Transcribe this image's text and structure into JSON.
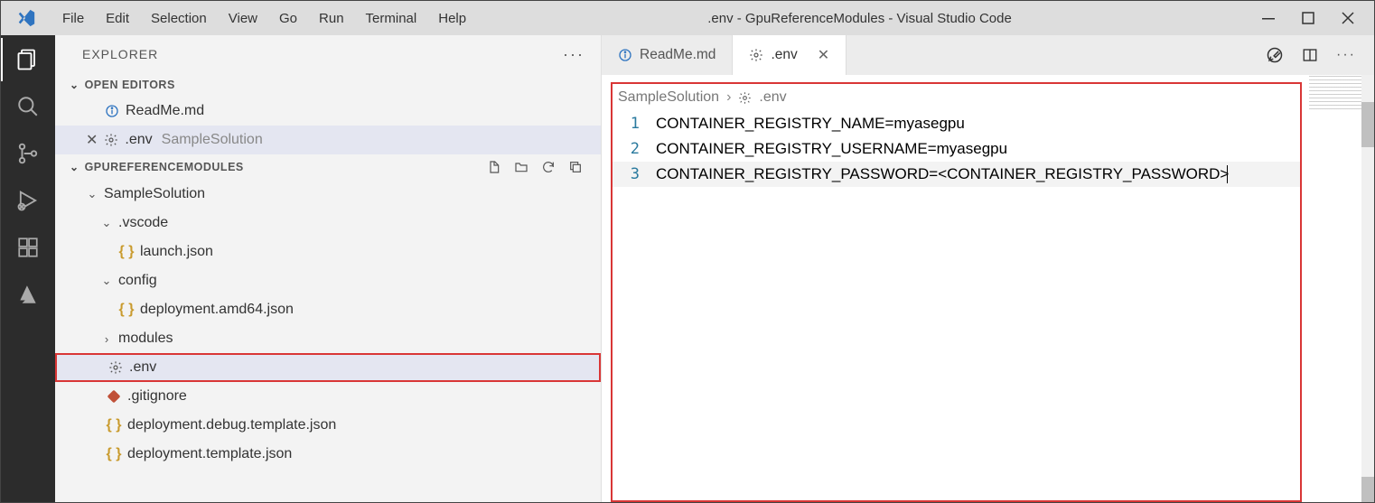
{
  "window": {
    "title": ".env - GpuReferenceModules - Visual Studio Code",
    "menus": [
      "File",
      "Edit",
      "Selection",
      "View",
      "Go",
      "Run",
      "Terminal",
      "Help"
    ]
  },
  "sidebar": {
    "title": "EXPLORER",
    "sections": {
      "open_editors": "OPEN EDITORS",
      "project": "GPUREFERENCEMODULES"
    },
    "open_editors": [
      {
        "icon": "info",
        "label": "ReadMe.md",
        "close": false
      },
      {
        "icon": "gear",
        "label": ".env",
        "detail": "SampleSolution",
        "close": true
      }
    ],
    "tree": {
      "root": "SampleSolution",
      "vscode": ".vscode",
      "launch": "launch.json",
      "config": "config",
      "deploy_amd": "deployment.amd64.json",
      "modules": "modules",
      "env": ".env",
      "gitignore": ".gitignore",
      "deploy_debug": "deployment.debug.template.json",
      "deploy_tpl": "deployment.template.json"
    }
  },
  "tabs": [
    {
      "icon": "info",
      "label": "ReadMe.md",
      "active": false
    },
    {
      "icon": "gear",
      "label": ".env",
      "active": true
    }
  ],
  "breadcrumb": {
    "parent": "SampleSolution",
    "file": ".env"
  },
  "code": {
    "l1": "CONTAINER_REGISTRY_NAME=myasegpu",
    "l2": "CONTAINER_REGISTRY_USERNAME=myasegpu",
    "l3": "CONTAINER_REGISTRY_PASSWORD=<CONTAINER_REGISTRY_PASSWORD>",
    "n1": "1",
    "n2": "2",
    "n3": "3"
  }
}
